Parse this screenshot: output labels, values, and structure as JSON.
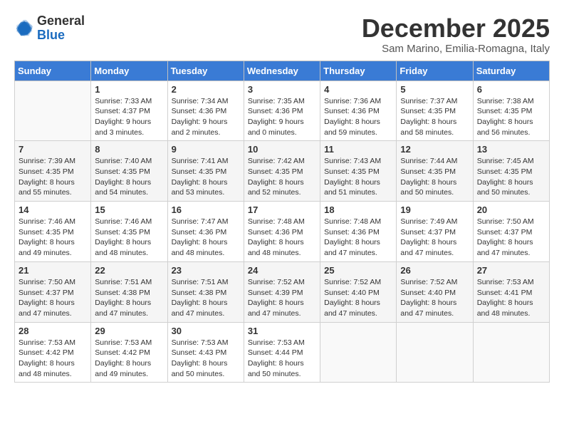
{
  "logo": {
    "general": "General",
    "blue": "Blue"
  },
  "header": {
    "month": "December 2025",
    "location": "Sam Marino, Emilia-Romagna, Italy"
  },
  "weekdays": [
    "Sunday",
    "Monday",
    "Tuesday",
    "Wednesday",
    "Thursday",
    "Friday",
    "Saturday"
  ],
  "weeks": [
    [
      {
        "day": "",
        "info": ""
      },
      {
        "day": "1",
        "info": "Sunrise: 7:33 AM\nSunset: 4:37 PM\nDaylight: 9 hours\nand 3 minutes."
      },
      {
        "day": "2",
        "info": "Sunrise: 7:34 AM\nSunset: 4:36 PM\nDaylight: 9 hours\nand 2 minutes."
      },
      {
        "day": "3",
        "info": "Sunrise: 7:35 AM\nSunset: 4:36 PM\nDaylight: 9 hours\nand 0 minutes."
      },
      {
        "day": "4",
        "info": "Sunrise: 7:36 AM\nSunset: 4:36 PM\nDaylight: 8 hours\nand 59 minutes."
      },
      {
        "day": "5",
        "info": "Sunrise: 7:37 AM\nSunset: 4:35 PM\nDaylight: 8 hours\nand 58 minutes."
      },
      {
        "day": "6",
        "info": "Sunrise: 7:38 AM\nSunset: 4:35 PM\nDaylight: 8 hours\nand 56 minutes."
      }
    ],
    [
      {
        "day": "7",
        "info": "Sunrise: 7:39 AM\nSunset: 4:35 PM\nDaylight: 8 hours\nand 55 minutes."
      },
      {
        "day": "8",
        "info": "Sunrise: 7:40 AM\nSunset: 4:35 PM\nDaylight: 8 hours\nand 54 minutes."
      },
      {
        "day": "9",
        "info": "Sunrise: 7:41 AM\nSunset: 4:35 PM\nDaylight: 8 hours\nand 53 minutes."
      },
      {
        "day": "10",
        "info": "Sunrise: 7:42 AM\nSunset: 4:35 PM\nDaylight: 8 hours\nand 52 minutes."
      },
      {
        "day": "11",
        "info": "Sunrise: 7:43 AM\nSunset: 4:35 PM\nDaylight: 8 hours\nand 51 minutes."
      },
      {
        "day": "12",
        "info": "Sunrise: 7:44 AM\nSunset: 4:35 PM\nDaylight: 8 hours\nand 50 minutes."
      },
      {
        "day": "13",
        "info": "Sunrise: 7:45 AM\nSunset: 4:35 PM\nDaylight: 8 hours\nand 50 minutes."
      }
    ],
    [
      {
        "day": "14",
        "info": "Sunrise: 7:46 AM\nSunset: 4:35 PM\nDaylight: 8 hours\nand 49 minutes."
      },
      {
        "day": "15",
        "info": "Sunrise: 7:46 AM\nSunset: 4:35 PM\nDaylight: 8 hours\nand 48 minutes."
      },
      {
        "day": "16",
        "info": "Sunrise: 7:47 AM\nSunset: 4:36 PM\nDaylight: 8 hours\nand 48 minutes."
      },
      {
        "day": "17",
        "info": "Sunrise: 7:48 AM\nSunset: 4:36 PM\nDaylight: 8 hours\nand 48 minutes."
      },
      {
        "day": "18",
        "info": "Sunrise: 7:48 AM\nSunset: 4:36 PM\nDaylight: 8 hours\nand 47 minutes."
      },
      {
        "day": "19",
        "info": "Sunrise: 7:49 AM\nSunset: 4:37 PM\nDaylight: 8 hours\nand 47 minutes."
      },
      {
        "day": "20",
        "info": "Sunrise: 7:50 AM\nSunset: 4:37 PM\nDaylight: 8 hours\nand 47 minutes."
      }
    ],
    [
      {
        "day": "21",
        "info": "Sunrise: 7:50 AM\nSunset: 4:37 PM\nDaylight: 8 hours\nand 47 minutes."
      },
      {
        "day": "22",
        "info": "Sunrise: 7:51 AM\nSunset: 4:38 PM\nDaylight: 8 hours\nand 47 minutes."
      },
      {
        "day": "23",
        "info": "Sunrise: 7:51 AM\nSunset: 4:38 PM\nDaylight: 8 hours\nand 47 minutes."
      },
      {
        "day": "24",
        "info": "Sunrise: 7:52 AM\nSunset: 4:39 PM\nDaylight: 8 hours\nand 47 minutes."
      },
      {
        "day": "25",
        "info": "Sunrise: 7:52 AM\nSunset: 4:40 PM\nDaylight: 8 hours\nand 47 minutes."
      },
      {
        "day": "26",
        "info": "Sunrise: 7:52 AM\nSunset: 4:40 PM\nDaylight: 8 hours\nand 47 minutes."
      },
      {
        "day": "27",
        "info": "Sunrise: 7:53 AM\nSunset: 4:41 PM\nDaylight: 8 hours\nand 48 minutes."
      }
    ],
    [
      {
        "day": "28",
        "info": "Sunrise: 7:53 AM\nSunset: 4:42 PM\nDaylight: 8 hours\nand 48 minutes."
      },
      {
        "day": "29",
        "info": "Sunrise: 7:53 AM\nSunset: 4:42 PM\nDaylight: 8 hours\nand 49 minutes."
      },
      {
        "day": "30",
        "info": "Sunrise: 7:53 AM\nSunset: 4:43 PM\nDaylight: 8 hours\nand 50 minutes."
      },
      {
        "day": "31",
        "info": "Sunrise: 7:53 AM\nSunset: 4:44 PM\nDaylight: 8 hours\nand 50 minutes."
      },
      {
        "day": "",
        "info": ""
      },
      {
        "day": "",
        "info": ""
      },
      {
        "day": "",
        "info": ""
      }
    ]
  ]
}
